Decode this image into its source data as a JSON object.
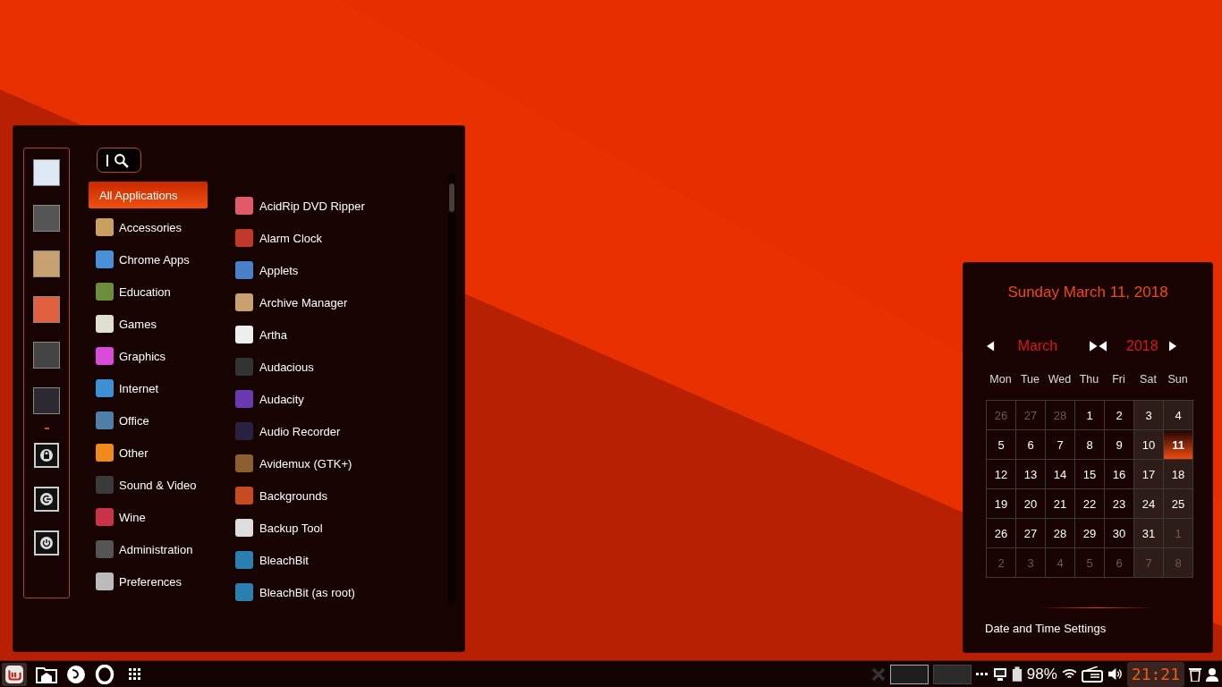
{
  "menu": {
    "categories": [
      {
        "label": "All Applications",
        "selected": true
      },
      {
        "label": "Accessories",
        "selected": false
      },
      {
        "label": "Chrome Apps",
        "selected": false
      },
      {
        "label": "Education",
        "selected": false
      },
      {
        "label": "Games",
        "selected": false
      },
      {
        "label": "Graphics",
        "selected": false
      },
      {
        "label": "Internet",
        "selected": false
      },
      {
        "label": "Office",
        "selected": false
      },
      {
        "label": "Other",
        "selected": false
      },
      {
        "label": "Sound & Video",
        "selected": false
      },
      {
        "label": "Wine",
        "selected": false
      },
      {
        "label": "Administration",
        "selected": false
      },
      {
        "label": "Preferences",
        "selected": false
      }
    ],
    "apps": [
      "AcidRip DVD Ripper",
      "Alarm Clock",
      "Applets",
      "Archive Manager",
      "Artha",
      "Audacious",
      "Audacity",
      "Audio Recorder",
      "Avidemux (GTK+)",
      "Backgrounds",
      "Backup Tool",
      "BleachBit",
      "BleachBit (as root)"
    ]
  },
  "calendar": {
    "title": "Sunday March 11, 2018",
    "month": "March",
    "year": "2018",
    "weekdays": [
      "Mon",
      "Tue",
      "Wed",
      "Thu",
      "Fri",
      "Sat",
      "Sun"
    ],
    "days": [
      {
        "day": "26",
        "in_month": false,
        "selected": false
      },
      {
        "day": "27",
        "in_month": false,
        "selected": false
      },
      {
        "day": "28",
        "in_month": false,
        "selected": false
      },
      {
        "day": "1",
        "in_month": true,
        "selected": false
      },
      {
        "day": "2",
        "in_month": true,
        "selected": false
      },
      {
        "day": "3",
        "in_month": true,
        "selected": false
      },
      {
        "day": "4",
        "in_month": true,
        "selected": false
      },
      {
        "day": "5",
        "in_month": true,
        "selected": false
      },
      {
        "day": "6",
        "in_month": true,
        "selected": false
      },
      {
        "day": "7",
        "in_month": true,
        "selected": false
      },
      {
        "day": "8",
        "in_month": true,
        "selected": false
      },
      {
        "day": "9",
        "in_month": true,
        "selected": false
      },
      {
        "day": "10",
        "in_month": true,
        "selected": false
      },
      {
        "day": "11",
        "in_month": true,
        "selected": true
      },
      {
        "day": "12",
        "in_month": true,
        "selected": false
      },
      {
        "day": "13",
        "in_month": true,
        "selected": false
      },
      {
        "day": "14",
        "in_month": true,
        "selected": false
      },
      {
        "day": "15",
        "in_month": true,
        "selected": false
      },
      {
        "day": "16",
        "in_month": true,
        "selected": false
      },
      {
        "day": "17",
        "in_month": true,
        "selected": false
      },
      {
        "day": "18",
        "in_month": true,
        "selected": false
      },
      {
        "day": "19",
        "in_month": true,
        "selected": false
      },
      {
        "day": "20",
        "in_month": true,
        "selected": false
      },
      {
        "day": "21",
        "in_month": true,
        "selected": false
      },
      {
        "day": "22",
        "in_month": true,
        "selected": false
      },
      {
        "day": "23",
        "in_month": true,
        "selected": false
      },
      {
        "day": "24",
        "in_month": true,
        "selected": false
      },
      {
        "day": "25",
        "in_month": true,
        "selected": false
      },
      {
        "day": "26",
        "in_month": true,
        "selected": false
      },
      {
        "day": "27",
        "in_month": true,
        "selected": false
      },
      {
        "day": "28",
        "in_month": true,
        "selected": false
      },
      {
        "day": "29",
        "in_month": true,
        "selected": false
      },
      {
        "day": "30",
        "in_month": true,
        "selected": false
      },
      {
        "day": "31",
        "in_month": true,
        "selected": false
      },
      {
        "day": "1",
        "in_month": false,
        "selected": false
      },
      {
        "day": "2",
        "in_month": false,
        "selected": false
      },
      {
        "day": "3",
        "in_month": false,
        "selected": false
      },
      {
        "day": "4",
        "in_month": false,
        "selected": false
      },
      {
        "day": "5",
        "in_month": false,
        "selected": false
      },
      {
        "day": "6",
        "in_month": false,
        "selected": false
      },
      {
        "day": "7",
        "in_month": false,
        "selected": false
      },
      {
        "day": "8",
        "in_month": false,
        "selected": false
      }
    ],
    "settings_link": "Date and Time Settings"
  },
  "taskbar": {
    "workspaces": [
      {
        "selected": true
      },
      {
        "selected": false
      }
    ],
    "battery": "98%",
    "clock": "21:21"
  }
}
